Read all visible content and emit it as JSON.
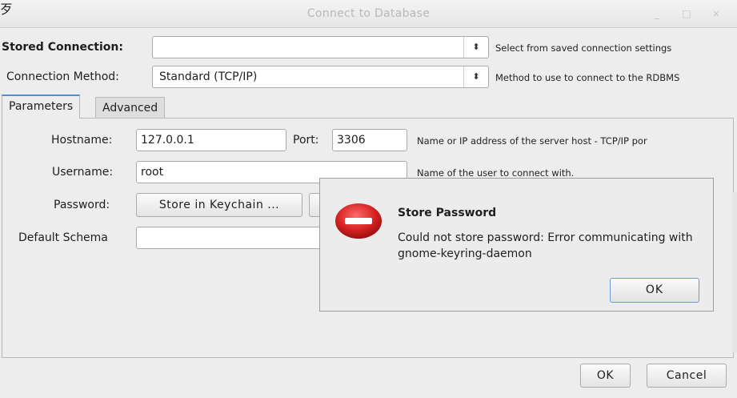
{
  "window": {
    "title": "Connect to Database",
    "app_icon": "wb-logo-icon",
    "controls": {
      "minimize": "_",
      "maximize": "□",
      "close": "×"
    }
  },
  "stored_connection": {
    "label": "Stored Connection:",
    "value": "",
    "hint": "Select from saved connection settings"
  },
  "connection_method": {
    "label": "Connection Method:",
    "value": "Standard (TCP/IP)",
    "hint": "Method to use to connect to the RDBMS"
  },
  "tabs": [
    {
      "label": "Parameters",
      "active": true
    },
    {
      "label": "Advanced",
      "active": false
    }
  ],
  "params": {
    "hostname_label": "Hostname:",
    "hostname_value": "127.0.0.1",
    "port_label": "Port:",
    "port_value": "3306",
    "hostname_hint": "Name or IP address of the server host - TCP/IP por",
    "username_label": "Username:",
    "username_value": "root",
    "username_hint": "Name of the user to connect with.",
    "password_label": "Password:",
    "store_keychain_label": "Store in Keychain ...",
    "default_schema_label": "Default Schema",
    "default_schema_value": ""
  },
  "footer": {
    "ok_label": "OK",
    "cancel_label": "Cancel"
  },
  "dialog": {
    "title": "Store Password",
    "message": "Could not store password: Error communicating with gnome-keyring-daemon",
    "ok_label": "OK",
    "icon": "error-icon",
    "icon_color": "#d42020"
  }
}
